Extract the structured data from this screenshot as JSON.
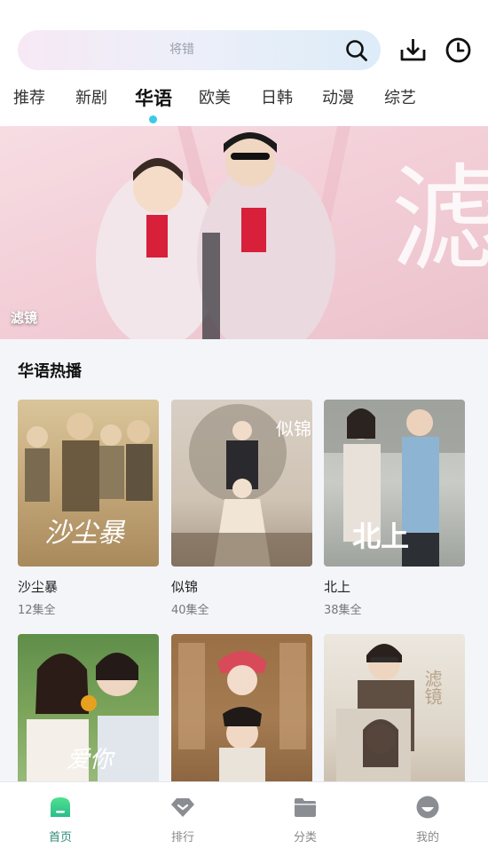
{
  "search": {
    "placeholder": "将错"
  },
  "top_icons": [
    "download-icon",
    "history-clock-icon"
  ],
  "tabs": [
    {
      "label": "推荐"
    },
    {
      "label": "新剧"
    },
    {
      "label": "华语",
      "active": true
    },
    {
      "label": "欧美"
    },
    {
      "label": "日韩"
    },
    {
      "label": "动漫"
    },
    {
      "label": "综艺"
    }
  ],
  "banner": {
    "caption": "滤镜",
    "watermark": "滤镜"
  },
  "section": {
    "title": "华语热播"
  },
  "cards": [
    {
      "title": "沙尘暴",
      "episodes": "12集全",
      "poster_text": "沙尘暴"
    },
    {
      "title": "似锦",
      "episodes": "40集全",
      "poster_text": "似锦"
    },
    {
      "title": "北上",
      "episodes": "38集全",
      "poster_text": "北上"
    },
    {
      "title": "",
      "episodes": "",
      "poster_text": "爱你"
    },
    {
      "title": "",
      "episodes": "",
      "poster_text": ""
    },
    {
      "title": "",
      "episodes": "",
      "poster_text": "滤镜"
    }
  ],
  "bottom_nav": [
    {
      "label": "首页",
      "icon": "home-icon",
      "active": true
    },
    {
      "label": "排行",
      "icon": "ranking-diamond-icon"
    },
    {
      "label": "分类",
      "icon": "folder-icon"
    },
    {
      "label": "我的",
      "icon": "profile-icon"
    }
  ],
  "colors": {
    "accent": "#2f8a79",
    "tab_dot": "#3cc9e6"
  }
}
